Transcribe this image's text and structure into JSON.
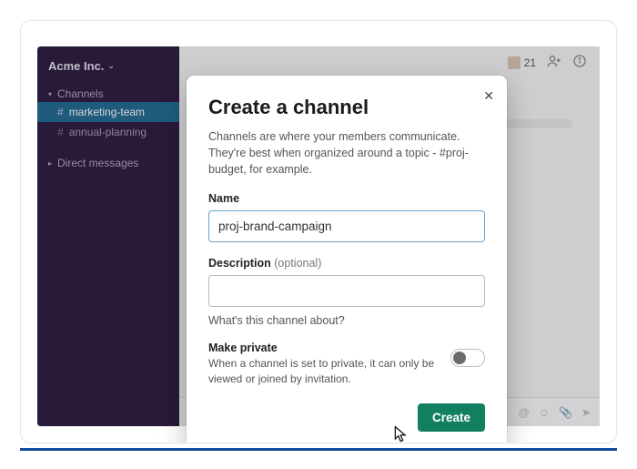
{
  "workspace": {
    "name": "Acme Inc."
  },
  "sidebar": {
    "channels_label": "Channels",
    "dm_label": "Direct messages",
    "items": [
      {
        "label": "marketing-team"
      },
      {
        "label": "annual-planning"
      }
    ]
  },
  "topbar": {
    "member_count": "21"
  },
  "modal": {
    "title": "Create a channel",
    "subtitle": "Channels are where your members communicate. They're best when organized around a topic - #proj-budget, for example.",
    "name_label": "Name",
    "name_value": "proj-brand-campaign",
    "desc_label": "Description",
    "desc_optional": "(optional)",
    "desc_value": "",
    "desc_helper": "What's this channel about?",
    "private_title": "Make private",
    "private_desc": "When a channel is set to private, it can only be viewed or joined by invitation.",
    "create_label": "Create"
  }
}
